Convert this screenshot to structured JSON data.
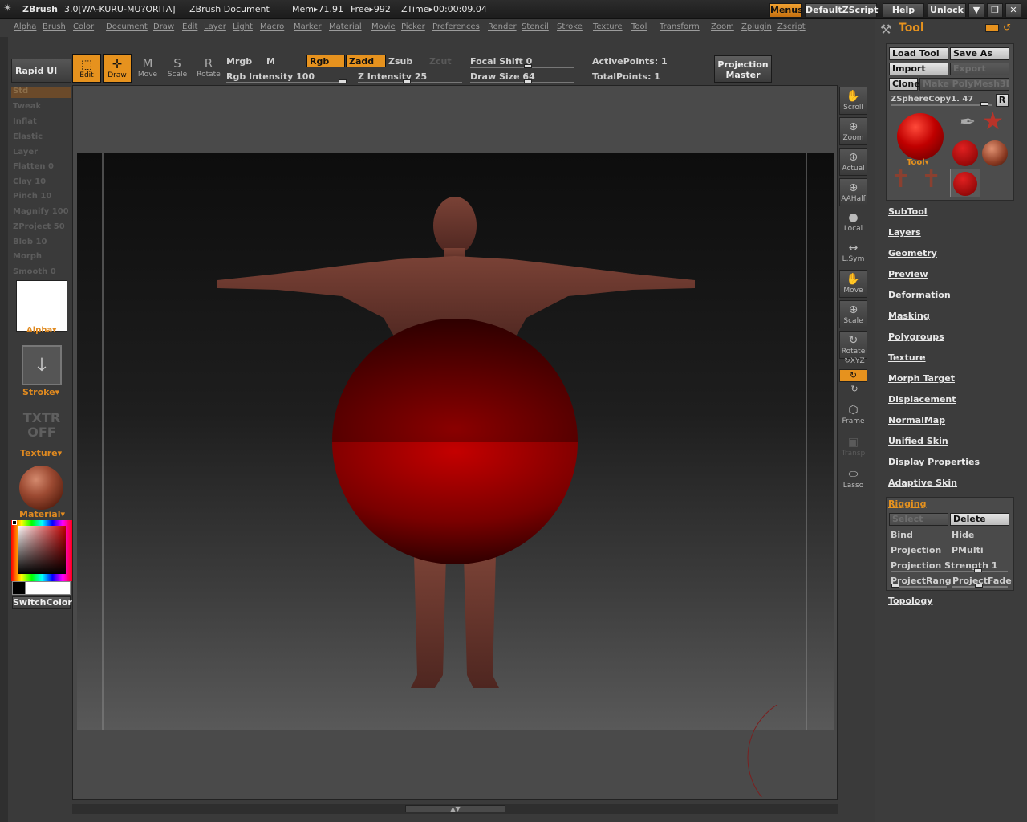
{
  "titlebar": {
    "app": "ZBrush",
    "version": "3.0[WA-KURU-MU?ORITA]",
    "document": "ZBrush Document",
    "mem": "Mem▸71.91",
    "free": "Free▸992",
    "ztime": "ZTime▸00:00:09.04",
    "buttons": [
      "Menus",
      "DefaultZScript",
      "Help",
      "Unlock"
    ]
  },
  "menus": [
    "Alpha",
    "Brush",
    "Color",
    "Document",
    "Draw",
    "Edit",
    "Layer",
    "Light",
    "Macro",
    "Marker",
    "Material",
    "Movie",
    "Picker",
    "Preferences",
    "Render",
    "Stencil",
    "Stroke",
    "Texture",
    "Tool",
    "Transform",
    "Zoom",
    "Zplugin",
    "Zscript"
  ],
  "left": {
    "rapid_ui": "Rapid UI",
    "brushes": [
      "Std",
      "Tweak",
      "Inflat",
      "Elastic",
      "Layer",
      "Flatten 0",
      "Clay 10",
      "Pinch 10",
      "Magnify 100",
      "ZProject 50",
      "Blob 10",
      "Morph",
      "Smooth 0"
    ],
    "alpha": "Alpha",
    "stroke": "Stroke",
    "txtr_off": "TXTR OFF",
    "texture": "Texture",
    "material": "Material",
    "switch_color": "SwitchColor"
  },
  "toolbar": {
    "edit": "Edit",
    "draw": "Draw",
    "move": "Move",
    "scale": "Scale",
    "rotate": "Rotate",
    "mrgb": "Mrgb",
    "m": "M",
    "rgb": "Rgb",
    "zadd": "Zadd",
    "zsub": "Zsub",
    "zcut": "Zcut",
    "rgb_intensity": "Rgb Intensity 100",
    "z_intensity": "Z Intensity 25",
    "focal_shift": "Focal Shift 0",
    "draw_size": "Draw Size 64",
    "active_points": "ActivePoints: 1",
    "total_points": "TotalPoints: 1",
    "projection_master": "Projection Master"
  },
  "shelf": [
    "Scroll",
    "Zoom",
    "Actual",
    "AAHalf",
    "Local",
    "L.Sym",
    "Move",
    "Scale",
    "Rotate",
    "XYZ",
    "Frame",
    "Transp",
    "Lasso"
  ],
  "tool": {
    "title": "Tool",
    "load_tool": "Load Tool",
    "save_as": "Save As",
    "import": "Import",
    "export": "Export",
    "clone": "Clone",
    "make_polymesh": "Make PolyMesh3D",
    "current": "ZSphereCopy1. 47",
    "r": "R",
    "thumb_label": "Tool",
    "sections": [
      "SubTool",
      "Layers",
      "Geometry",
      "Preview",
      "Deformation",
      "Masking",
      "Polygroups",
      "Texture",
      "Morph Target",
      "Displacement",
      "NormalMap",
      "Unified Skin",
      "Display Properties",
      "Adaptive Skin"
    ],
    "rigging": {
      "title": "Rigging",
      "select": "Select",
      "delete": "Delete",
      "bind": "Bind",
      "hide": "Hide",
      "projection": "Projection",
      "pmulti": "PMulti",
      "projection_strength": "Projection Strength 1",
      "projection_range": "ProjectRang",
      "projection_fade": "ProjectFade"
    },
    "topology": "Topology"
  },
  "colors": {
    "accent": "#e6921e",
    "sphere": "#b00000",
    "figure": "#6e3a30"
  }
}
